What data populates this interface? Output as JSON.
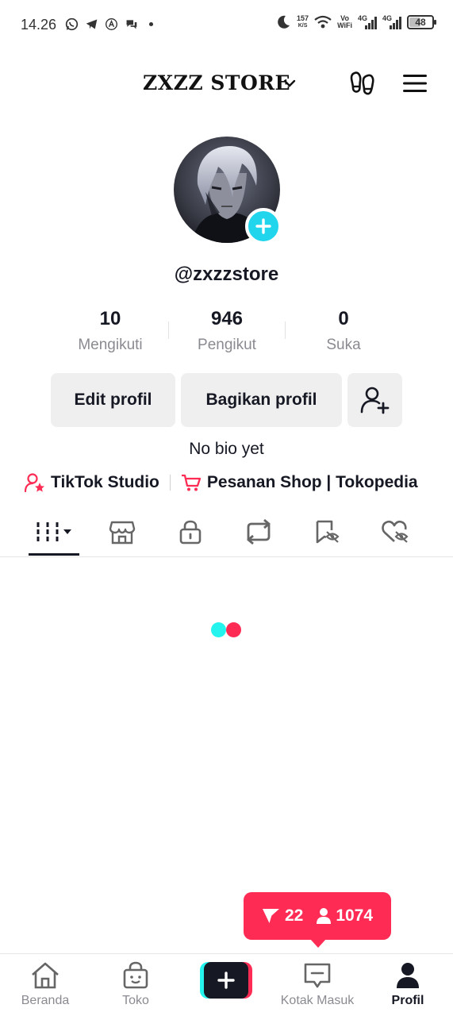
{
  "status_bar": {
    "time": "14.26",
    "speed_value": "157",
    "speed_unit": "K/S",
    "vowifi_top": "Vo",
    "vowifi_bottom": "WiFi",
    "sim1": "4G",
    "sim2": "4G",
    "battery": "48",
    "battery_level": 0.48
  },
  "header": {
    "account_name": "ZXZZ STORE"
  },
  "profile": {
    "handle": "@zxzzstore",
    "stats": [
      {
        "value": "10",
        "label": "Mengikuti"
      },
      {
        "value": "946",
        "label": "Pengikut"
      },
      {
        "value": "0",
        "label": "Suka"
      }
    ],
    "edit_button": "Edit profil",
    "share_button": "Bagikan profil",
    "bio": "No bio yet",
    "links": [
      {
        "label": "TikTok Studio",
        "icon": "person-star-icon"
      },
      {
        "label": "Pesanan Shop | Tokopedia",
        "icon": "shopping-cart-icon"
      }
    ]
  },
  "tabs": [
    {
      "icon": "videos-grid-icon",
      "selected": true
    },
    {
      "icon": "shop-icon",
      "selected": false
    },
    {
      "icon": "lock-icon",
      "selected": false
    },
    {
      "icon": "repost-icon",
      "selected": false
    },
    {
      "icon": "bookmark-hidden-icon",
      "selected": false
    },
    {
      "icon": "heart-hidden-icon",
      "selected": false
    }
  ],
  "live_pill": {
    "filter_count": "22",
    "viewer_count": "1074"
  },
  "bottom_nav": {
    "home": "Beranda",
    "shop": "Toko",
    "inbox": "Kotak Masuk",
    "profile": "Profil"
  },
  "colors": {
    "accent_red": "#fe2c55",
    "accent_cyan": "#25f4ee",
    "avatar_plus": "#20d5ec",
    "text_dark": "#161823",
    "text_gray": "#8a8b91"
  }
}
